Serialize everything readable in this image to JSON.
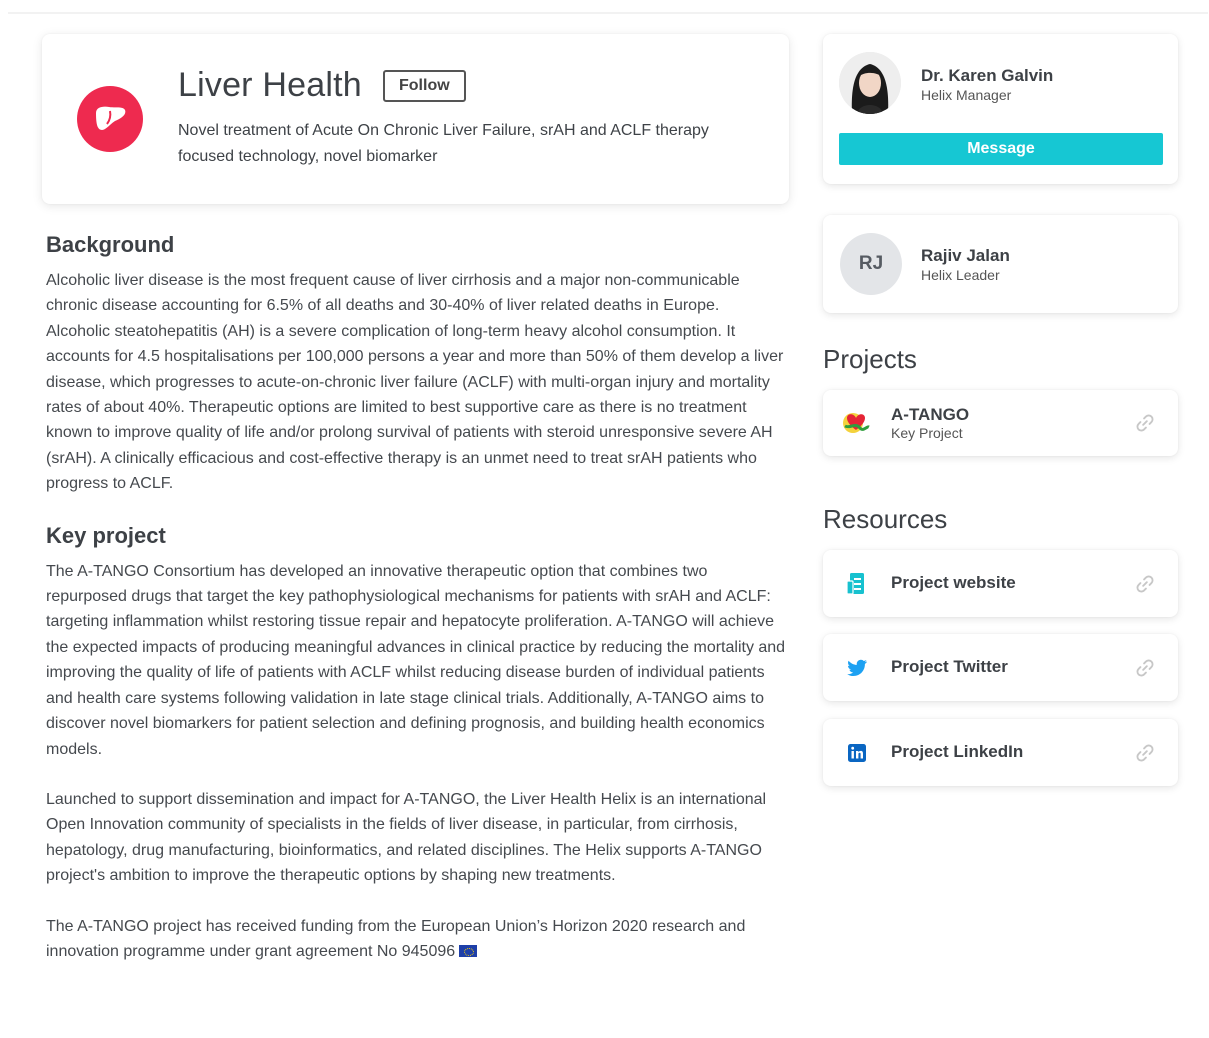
{
  "topic": {
    "title": "Liver Health",
    "follow_label": "Follow",
    "description": "Novel treatment of Acute On Chronic Liver Failure, srAH and ACLF therapy focused technology, novel biomarker"
  },
  "background": {
    "heading": "Background",
    "text": "Alcoholic liver disease is the most frequent cause of liver cirrhosis and a major non-communicable chronic disease accounting for 6.5% of all deaths and 30-40% of liver related deaths in Europe. Alcoholic steatohepatitis (AH) is a severe complication of long-term heavy alcohol consumption. It accounts for 4.5 hospitalisations per 100,000 persons a year and more than 50% of them develop a liver disease, which progresses to acute-on-chronic liver failure (ACLF) with multi-organ injury and mortality rates of about 40%. Therapeutic options are limited to best supportive care as there is no treatment known to improve quality of life and/or prolong survival of patients with steroid unresponsive severe AH (srAH). A clinically efficacious and cost-effective therapy is an unmet need to treat srAH patients who progress to ACLF."
  },
  "key_project": {
    "heading": "Key project",
    "paragraphs": [
      "The A-TANGO Consortium has developed an innovative therapeutic option that combines two repurposed drugs that target the key pathophysiological mechanisms for patients with srAH and ACLF: targeting inflammation whilst restoring tissue repair and hepatocyte proliferation. A-TANGO will achieve the expected impacts of producing meaningful advances in clinical practice by reducing the mortality and improving the quality of life of patients with ACLF whilst reducing disease burden of individual patients and health care systems following validation in late stage clinical trials. Additionally, A-TANGO aims to discover novel biomarkers for patient selection and defining prognosis, and building health economics models.",
      "Launched to support dissemination and impact for A-TANGO, the Liver Health Helix is an international Open Innovation community of specialists in the fields of liver disease, in particular, from cirrhosis, hepatology, drug manufacturing, bioinformatics, and related disciplines. The Helix supports A-TANGO project's ambition to improve the therapeutic options by shaping new treatments.",
      "The A-TANGO project has received funding from the European Union’s Horizon 2020 research and innovation programme under grant agreement No 945096"
    ]
  },
  "manager": {
    "name": "Dr. Karen Galvin",
    "role": "Helix Manager",
    "message_label": "Message"
  },
  "leader": {
    "initials": "RJ",
    "name": "Rajiv Jalan",
    "role": "Helix Leader"
  },
  "projects": {
    "heading": "Projects",
    "items": [
      {
        "name": "A-TANGO",
        "subtitle": "Key Project"
      }
    ]
  },
  "resources": {
    "heading": "Resources",
    "items": [
      {
        "label": "Project website",
        "icon": "website-icon"
      },
      {
        "label": "Project Twitter",
        "icon": "twitter-icon"
      },
      {
        "label": "Project LinkedIn",
        "icon": "linkedin-icon"
      }
    ]
  },
  "colors": {
    "accent": "#16c7d3",
    "topic_icon_bg": "#ee2a4f",
    "twitter": "#1da1f2",
    "linkedin": "#0a66c2"
  }
}
